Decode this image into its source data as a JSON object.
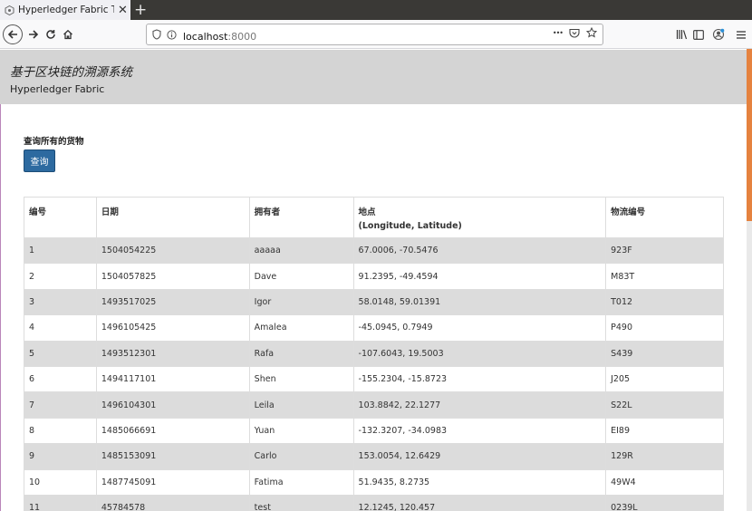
{
  "browser": {
    "tab_title": "Hyperledger Fabric Tuna",
    "url_host": "localhost",
    "url_port": ":8000",
    "url_right_dots": "•••"
  },
  "header": {
    "title": "基于区块链的溯源系统",
    "subtitle": "Hyperledger Fabric"
  },
  "query": {
    "label": "查询所有的货物",
    "button": "查询"
  },
  "table": {
    "columns": [
      "编号",
      "日期",
      "拥有者",
      "地点",
      "物流编号"
    ],
    "location_sub": "(Longitude, Latitude)",
    "rows": [
      [
        "1",
        "1504054225",
        "aaaaa",
        "67.0006, -70.5476",
        "923F"
      ],
      [
        "2",
        "1504057825",
        "Dave",
        "91.2395, -49.4594",
        "M83T"
      ],
      [
        "3",
        "1493517025",
        "Igor",
        "58.0148, 59.01391",
        "T012"
      ],
      [
        "4",
        "1496105425",
        "Amalea",
        "-45.0945, 0.7949",
        "P490"
      ],
      [
        "5",
        "1493512301",
        "Rafa",
        "-107.6043, 19.5003",
        "S439"
      ],
      [
        "6",
        "1494117101",
        "Shen",
        "-155.2304, -15.8723",
        "J205"
      ],
      [
        "7",
        "1496104301",
        "Leila",
        "103.8842, 22.1277",
        "S22L"
      ],
      [
        "8",
        "1485066691",
        "Yuan",
        "-132.3207, -34.0983",
        "EI89"
      ],
      [
        "9",
        "1485153091",
        "Carlo",
        "153.0054, 12.6429",
        "129R"
      ],
      [
        "10",
        "1487745091",
        "Fatima",
        "51.9435, 8.2735",
        "49W4"
      ],
      [
        "11",
        "45784578",
        "test",
        "12.1245, 120.457",
        "0239L"
      ]
    ]
  }
}
